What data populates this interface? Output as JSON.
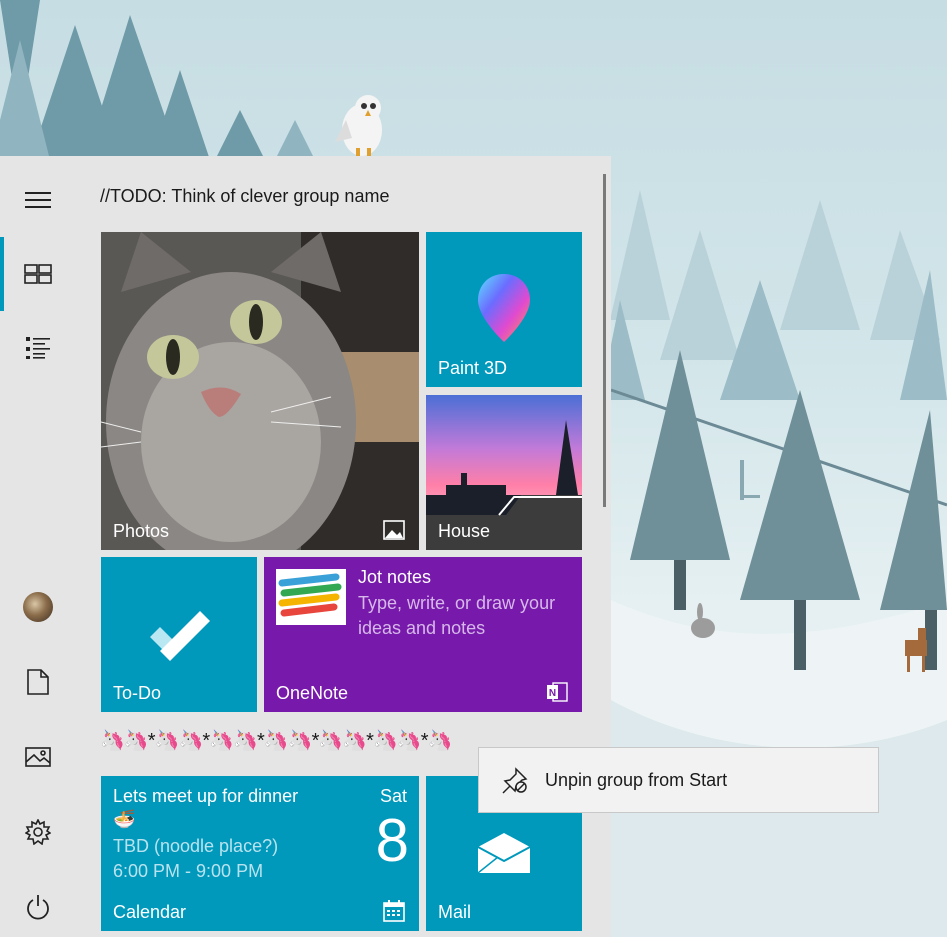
{
  "start_menu": {
    "rail": {
      "menu_icon": "hamburger-icon",
      "tiles_icon": "all-tiles-icon",
      "list_icon": "app-list-icon",
      "account_icon": "avatar",
      "documents_icon": "document-icon",
      "pictures_icon": "pictures-icon",
      "settings_icon": "gear-icon",
      "power_icon": "power-icon"
    },
    "group1_title": "//TODO: Think of clever group name",
    "group2_title": "🦄🦄*🦄🦄*🦄🦄*🦄🦄*🦄🦄*🦄🦄*🦄",
    "tiles": {
      "photos": "Photos",
      "paint3d": "Paint 3D",
      "house": "House",
      "todo": "To-Do",
      "onenote": "OneNote",
      "onenote_heading": "Jot notes",
      "onenote_desc": "Type, write, or draw your ideas and notes",
      "calendar": "Calendar",
      "calendar_event": "Lets meet up for dinner",
      "calendar_emoji": "🍜",
      "calendar_location": "TBD (noodle place?)",
      "calendar_time": "6:00 PM - 9:00 PM",
      "calendar_day": "Sat",
      "calendar_date": "8",
      "mail": "Mail"
    }
  },
  "context_menu": {
    "unpin_label": "Unpin group from Start",
    "unpin_icon": "unpin-icon"
  },
  "colors": {
    "accent": "#0099bc",
    "onenote": "#7719aa",
    "menu_bg": "#e5e5e5"
  }
}
